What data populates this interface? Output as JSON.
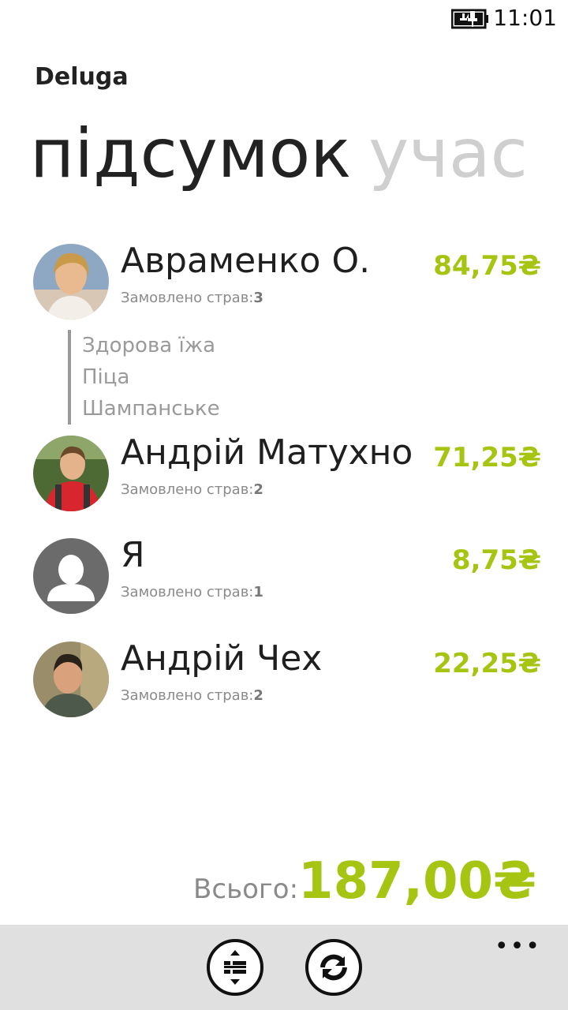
{
  "status_bar": {
    "time": "11:01",
    "battery_icon": "battery-charging-icon"
  },
  "app": {
    "title": "Deluga"
  },
  "pivot": {
    "active": "підсумок",
    "next": "учас"
  },
  "people": [
    {
      "name": "Авраменко О.",
      "ordered_label": "Замовлено страв:",
      "ordered_count": "3",
      "amount": "84,75₴",
      "avatar": "photo-avatar"
    },
    {
      "name": "Андрій Матухно",
      "ordered_label": "Замовлено страв:",
      "ordered_count": "2",
      "amount": "71,25₴",
      "avatar": "photo-avatar"
    },
    {
      "name": "Я",
      "ordered_label": "Замовлено страв:",
      "ordered_count": "1",
      "amount": "8,75₴",
      "avatar": "default-person-icon"
    },
    {
      "name": "Андрій Чех",
      "ordered_label": "Замовлено страв:",
      "ordered_count": "2",
      "amount": "22,25₴",
      "avatar": "photo-avatar"
    }
  ],
  "expanded_dishes": [
    "Здорова їжа",
    "Піца",
    "Шампанське"
  ],
  "total": {
    "label": "Всього:",
    "value": "187,00₴"
  },
  "app_bar": {
    "buttons": [
      "expand-collapse-icon",
      "refresh-icon"
    ],
    "more": "•••"
  },
  "colors": {
    "accent": "#a6c412",
    "appbar": "#e0e0e0"
  }
}
